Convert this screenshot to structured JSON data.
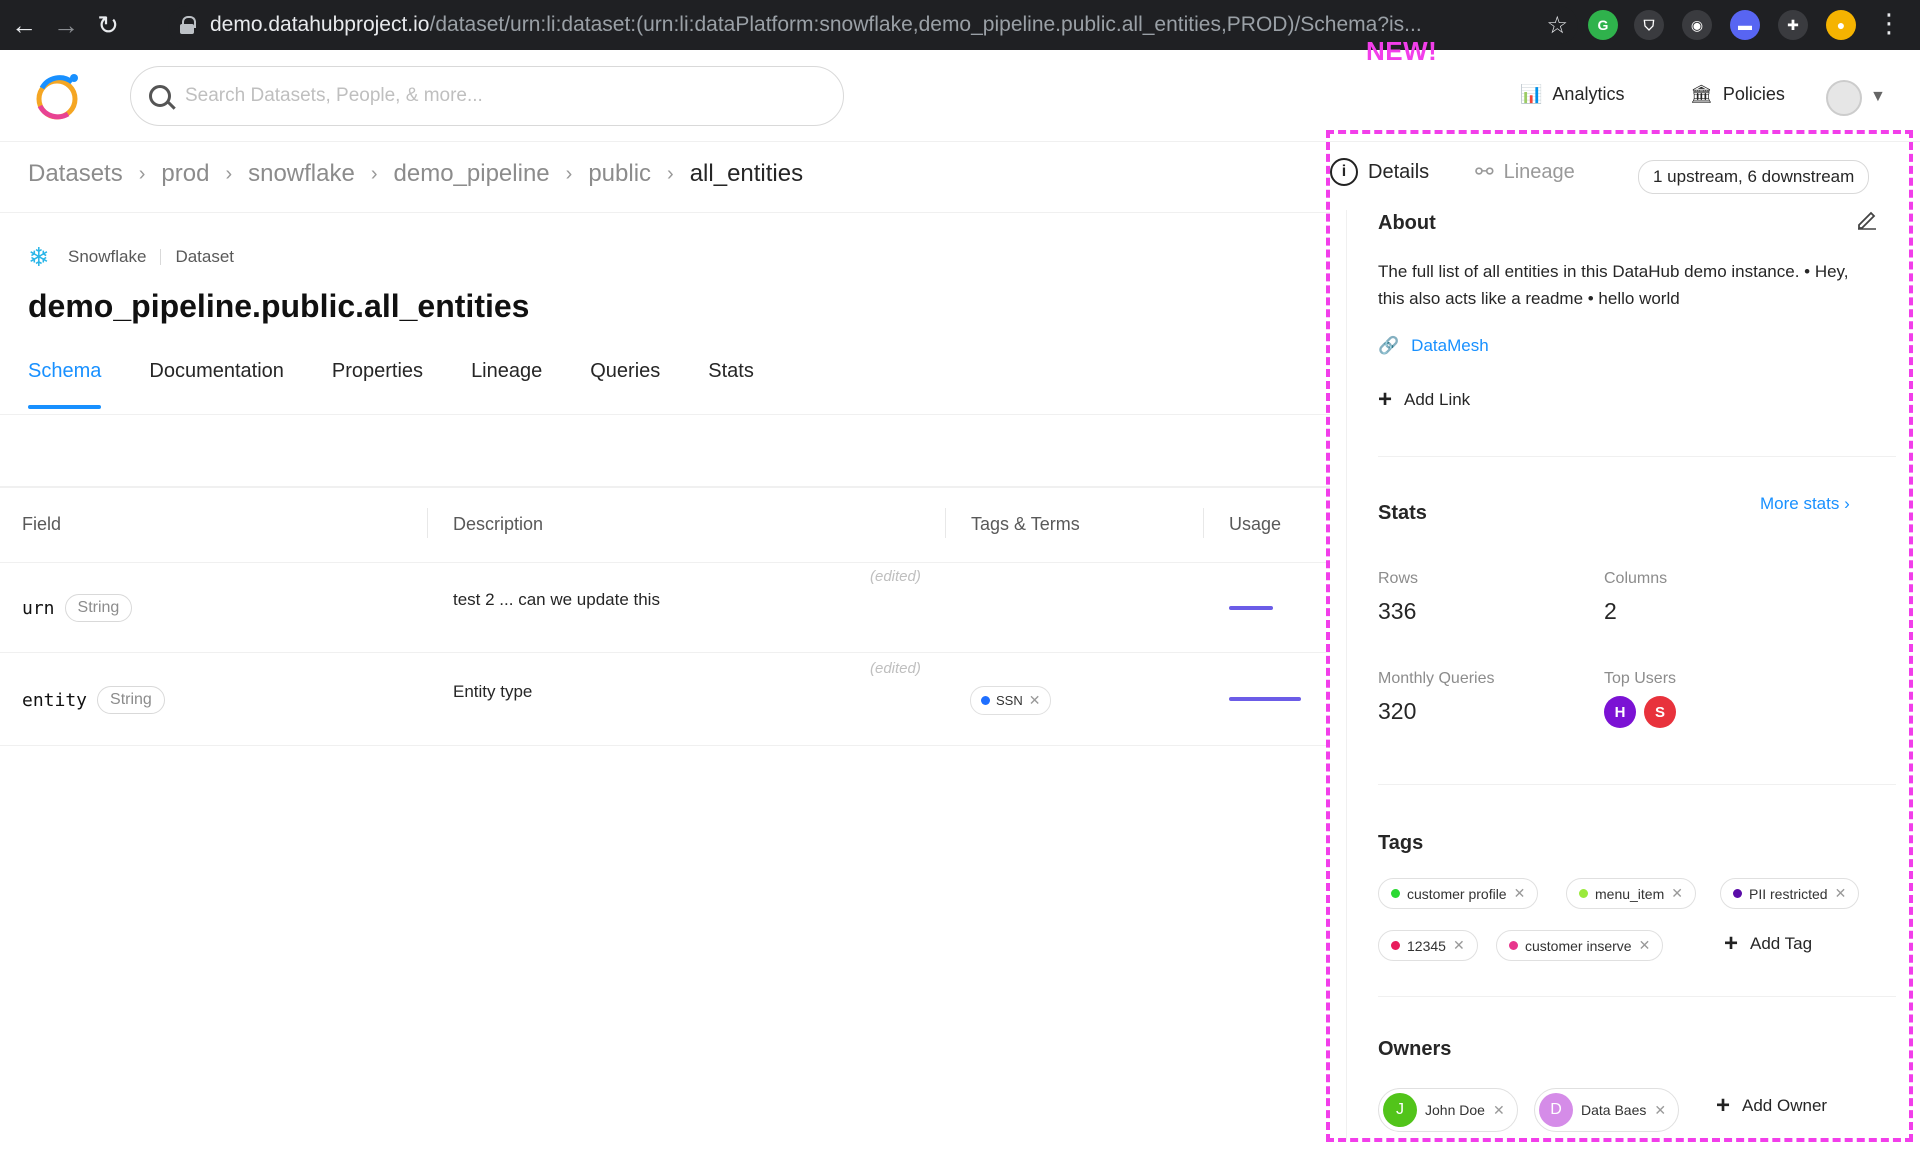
{
  "browser": {
    "url_host": "demo.datahubproject.io",
    "url_path": "/dataset/urn:li:dataset:(urn:li:dataPlatform:snowflake,demo_pipeline.public.all_entities,PROD)/Schema?is..."
  },
  "header": {
    "search_placeholder": "Search Datasets, People, & more...",
    "new_badge": "NEW!",
    "analytics_label": "Analytics",
    "policies_label": "Policies"
  },
  "breadcrumb": [
    "Datasets",
    "prod",
    "snowflake",
    "demo_pipeline",
    "public",
    "all_entities"
  ],
  "entity": {
    "platform": "Snowflake",
    "type": "Dataset",
    "title": "demo_pipeline.public.all_entities"
  },
  "tabs": [
    "Schema",
    "Documentation",
    "Properties",
    "Lineage",
    "Queries",
    "Stats"
  ],
  "schema": {
    "columns": [
      "Field",
      "Description",
      "Tags & Terms",
      "Usage"
    ],
    "rows": [
      {
        "field": "urn",
        "type": "String",
        "description": "test 2 ... can we update this",
        "edited": "(edited)",
        "terms": [],
        "usage": 0.55
      },
      {
        "field": "entity",
        "type": "String",
        "description": "Entity type",
        "edited": "(edited)",
        "terms": [
          {
            "label": "SSN",
            "color": "#1f6fff"
          }
        ],
        "usage": 0.9
      }
    ]
  },
  "sidebar": {
    "tab_details": "Details",
    "tab_lineage": "Lineage",
    "lineage_summary": "1 upstream, 6 downstream",
    "about_title": "About",
    "about_text": "The full list of all entities in this DataHub demo instance. • Hey, this also acts like a readme • hello world",
    "link_label": "DataMesh",
    "add_link": "Add Link",
    "stats_title": "Stats",
    "more_stats": "More stats ›",
    "rows_label": "Rows",
    "rows_value": "336",
    "columns_label": "Columns",
    "columns_value": "2",
    "queries_label": "Monthly Queries",
    "queries_value": "320",
    "top_users_label": "Top Users",
    "top_users": [
      {
        "initial": "H",
        "color": "#7b12d4"
      },
      {
        "initial": "S",
        "color": "#e8323c"
      }
    ],
    "tags_title": "Tags",
    "tags": [
      {
        "label": "customer profile",
        "color": "#2bd933"
      },
      {
        "label": "menu_item",
        "color": "#9bea3c"
      },
      {
        "label": "PII restricted",
        "color": "#5a0ca8"
      },
      {
        "label": "12345",
        "color": "#e81d5c"
      },
      {
        "label": "customer inserve",
        "color": "#e8368d"
      }
    ],
    "add_tag": "Add Tag",
    "owners_title": "Owners",
    "owners": [
      {
        "initial": "J",
        "name": "John Doe",
        "color": "#52c41a"
      },
      {
        "initial": "D",
        "name": "Data Baes",
        "color": "#d58ce8"
      }
    ],
    "add_owner": "Add Owner"
  },
  "colors": {
    "accent": "#1890ff",
    "highlight": "#f23eea",
    "usage": "#6b5ce7"
  }
}
